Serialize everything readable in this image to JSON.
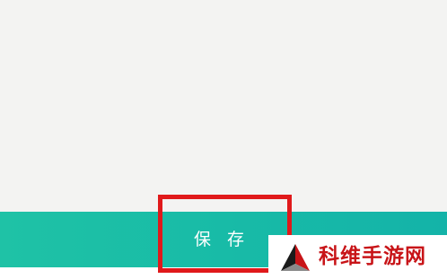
{
  "save_button": {
    "label": "保 存"
  },
  "watermark": {
    "text": "科维手游网"
  },
  "colors": {
    "background": "#f3f3f2",
    "save_bar": "#18bba7",
    "highlight_border": "#e0191b",
    "watermark_text": "#c81418"
  }
}
